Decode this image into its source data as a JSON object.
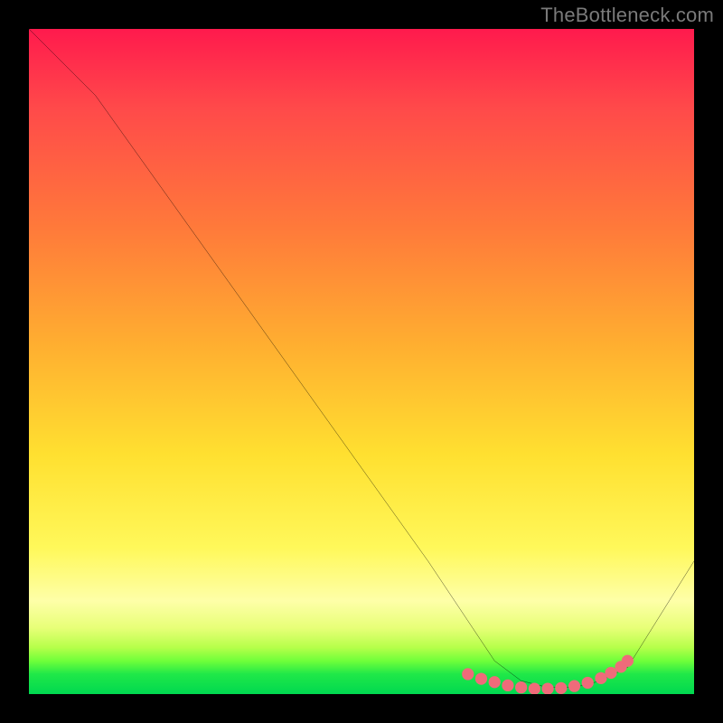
{
  "watermark": "TheBottleneck.com",
  "chart_data": {
    "type": "line",
    "title": "",
    "xlabel": "",
    "ylabel": "",
    "xlim": [
      0,
      100
    ],
    "ylim": [
      0,
      100
    ],
    "series": [
      {
        "name": "curve",
        "x": [
          0,
          6,
          10,
          20,
          30,
          40,
          50,
          60,
          66,
          70,
          74,
          78,
          82,
          86,
          90,
          100
        ],
        "y": [
          100,
          94,
          90,
          76,
          62,
          48,
          34,
          20,
          11,
          5,
          2,
          1,
          1,
          2,
          4,
          20
        ]
      }
    ],
    "markers": {
      "name": "optimal-range",
      "color": "#ef6b7a",
      "x": [
        66,
        68,
        70,
        72,
        74,
        76,
        78,
        80,
        82,
        84,
        86,
        87.5,
        89,
        90
      ],
      "y": [
        3.0,
        2.3,
        1.8,
        1.3,
        1.0,
        0.8,
        0.8,
        0.9,
        1.2,
        1.7,
        2.4,
        3.2,
        4.1,
        5.0
      ]
    },
    "gradient_stops": [
      {
        "pos": 0.0,
        "color": "#ff1a4d"
      },
      {
        "pos": 0.12,
        "color": "#ff4a4a"
      },
      {
        "pos": 0.3,
        "color": "#ff7a3a"
      },
      {
        "pos": 0.48,
        "color": "#ffb030"
      },
      {
        "pos": 0.64,
        "color": "#ffe030"
      },
      {
        "pos": 0.78,
        "color": "#fff85a"
      },
      {
        "pos": 0.86,
        "color": "#feffa8"
      },
      {
        "pos": 0.9,
        "color": "#e8ff78"
      },
      {
        "pos": 0.93,
        "color": "#b6ff4a"
      },
      {
        "pos": 0.95,
        "color": "#70ff3a"
      },
      {
        "pos": 0.97,
        "color": "#20e848"
      },
      {
        "pos": 1.0,
        "color": "#00d850"
      }
    ]
  }
}
